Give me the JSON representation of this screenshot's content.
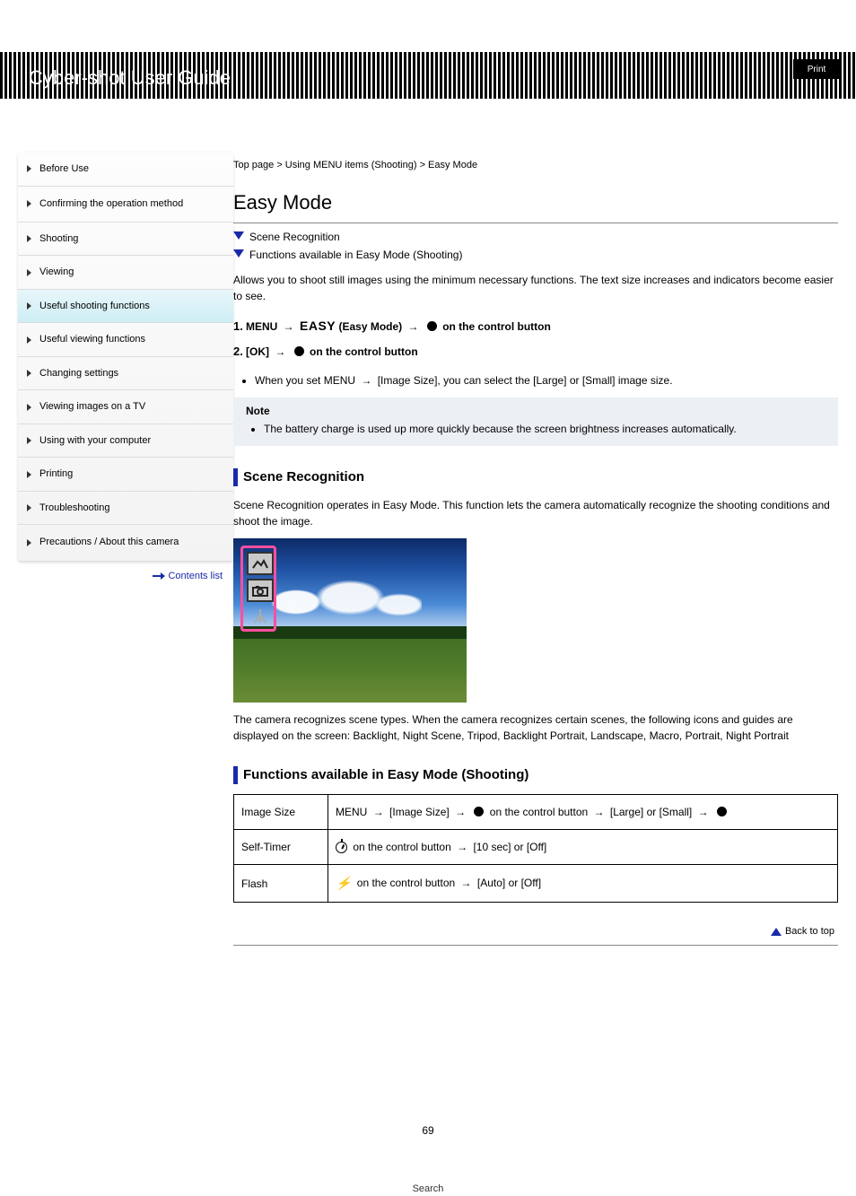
{
  "header": {
    "title": "Cyber-shot User Guide",
    "search_label": "Search",
    "print_label": "Print"
  },
  "breadcrumb": "Top page > Using MENU items (Shooting) > Easy Mode",
  "sidebar": {
    "items": [
      {
        "label": "Before Use"
      },
      {
        "label": "Confirming the operation method"
      },
      {
        "label": "Shooting"
      },
      {
        "label": "Viewing"
      },
      {
        "label": "Useful shooting functions"
      },
      {
        "label": "Useful viewing functions"
      },
      {
        "label": "Changing settings"
      },
      {
        "label": "Viewing images on a TV"
      },
      {
        "label": "Using with your computer"
      },
      {
        "label": "Printing"
      },
      {
        "label": "Troubleshooting"
      },
      {
        "label": "Precautions / About this camera"
      }
    ],
    "active_index": 4,
    "bottom_link": "Contents list"
  },
  "content": {
    "h1": "Easy Mode",
    "toc": [
      "Scene Recognition",
      "Functions available in Easy Mode (Shooting)"
    ],
    "intro": "Allows you to shoot still images using the minimum necessary functions. The text size increases and indicators become easier to see.",
    "steps": [
      {
        "n": "1.",
        "text_before": "MENU ",
        "easy": "EASY",
        "text_mid": " (Easy Mode) ",
        "text_after": " on the control button"
      },
      {
        "n": "2.",
        "text_before": "[OK] ",
        "text_after": " on the control button"
      }
    ],
    "bullets": [
      {
        "before": "When you set MENU ",
        "after": " [Image Size], you can select the [Large] or [Small] image size."
      }
    ],
    "note": {
      "label": "Note",
      "text": "The battery charge is used up more quickly because the screen brightness increases automatically."
    },
    "scene": {
      "heading": "Scene Recognition",
      "p1": "Scene Recognition operates in Easy Mode. This function lets the camera automatically recognize the shooting conditions and shoot the image.",
      "p2": "The camera recognizes scene types. When the camera recognizes certain scenes, the following icons and guides are displayed on the screen: Backlight, Night Scene, Tripod, Backlight Portrait, Landscape, Macro, Portrait, Night Portrait"
    },
    "functions": {
      "heading": "Functions available in Easy Mode (Shooting)",
      "rows": [
        {
          "label": "Image Size",
          "cell": {
            "a": "MENU",
            "b": "[Image Size]",
            "c": "on the control button",
            "d": "[Large] or [Small]",
            "e": ""
          }
        },
        {
          "label": "Self-Timer",
          "cell": {
            "icon": "timer",
            "a": "on the control button",
            "b": "[10 sec] or [Off]"
          }
        },
        {
          "label": "Flash",
          "cell": {
            "icon": "flash",
            "a": "on the control button",
            "b": "[Auto] or [Off]"
          }
        }
      ]
    },
    "back_top": "Back to top"
  },
  "page_number": "69"
}
